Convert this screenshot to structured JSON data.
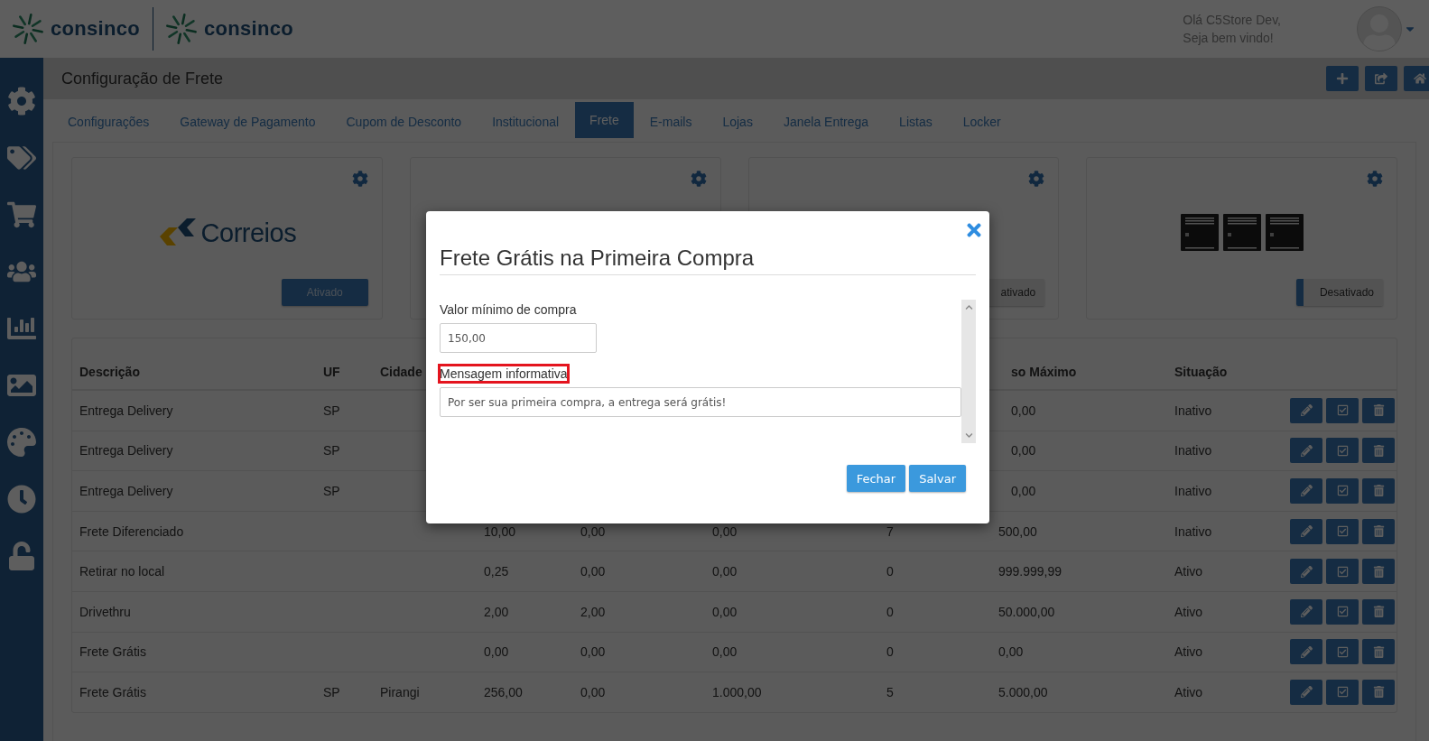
{
  "header": {
    "logos": [
      {
        "text": "consinco"
      },
      {
        "text": "consinco"
      }
    ],
    "greeting": "Olá C5Store Dev,",
    "welcome": "Seja bem vindo!"
  },
  "page": {
    "title": "Configuração de Frete"
  },
  "tabs": [
    {
      "label": "Configurações",
      "selected": false
    },
    {
      "label": "Gateway de Pagamento",
      "selected": false
    },
    {
      "label": "Cupom de Desconto",
      "selected": false
    },
    {
      "label": "Institucional",
      "selected": false
    },
    {
      "label": "Frete",
      "selected": true
    },
    {
      "label": "E-mails",
      "selected": false
    },
    {
      "label": "Lojas",
      "selected": false
    },
    {
      "label": "Janela Entrega",
      "selected": false
    },
    {
      "label": "Listas",
      "selected": false
    },
    {
      "label": "Locker",
      "selected": false
    }
  ],
  "cards": [
    {
      "kind": "correios",
      "logo_text": "Correios",
      "button": {
        "label": "Ativado",
        "on": true
      }
    },
    {
      "kind": "blank"
    },
    {
      "kind": "blank",
      "button": {
        "label": "ativado",
        "on": false
      }
    },
    {
      "kind": "lockers",
      "button": {
        "label": "Desativado",
        "on": false
      }
    }
  ],
  "table": {
    "columns": [
      {
        "label": "Descrição"
      },
      {
        "label": "UF"
      },
      {
        "label": "Cidade"
      },
      {},
      {},
      {},
      {},
      {
        "label": "so Máximo"
      },
      {
        "label": "Situação"
      }
    ],
    "rows": [
      {
        "cells": [
          "Entrega Delivery",
          "SP",
          null,
          null,
          null,
          null,
          null,
          "0,00",
          "Inativo"
        ]
      },
      {
        "cells": [
          "Entrega Delivery",
          "SP",
          null,
          null,
          null,
          null,
          null,
          "0,00",
          "Inativo"
        ]
      },
      {
        "cells": [
          "Entrega Delivery",
          "SP",
          null,
          null,
          null,
          null,
          null,
          "0,00",
          "Inativo"
        ]
      },
      {
        "cells": [
          "Frete Diferenciado",
          null,
          null,
          "10,00",
          "0,00",
          "0,00",
          "7",
          "500,00",
          "Inativo"
        ]
      },
      {
        "cells": [
          "Retirar no local",
          null,
          null,
          "0,25",
          "0,00",
          "0,00",
          "0",
          "999.999,99",
          "Ativo"
        ]
      },
      {
        "cells": [
          "Drivethru",
          null,
          null,
          "2,00",
          "2,00",
          "0,00",
          "0",
          "50.000,00",
          "Ativo"
        ]
      },
      {
        "cells": [
          "Frete Grátis",
          null,
          null,
          "0,00",
          "0,00",
          "0,00",
          "0",
          "0,00",
          "Ativo"
        ]
      },
      {
        "cells": [
          "Frete Grátis",
          "SP",
          "Pirangi",
          "256,00",
          "0,00",
          "1.000,00",
          "5",
          "5.000,00",
          "Ativo"
        ]
      }
    ]
  },
  "modal": {
    "title": "Frete Grátis na Primeira Compra",
    "fields": [
      {
        "kind": "short",
        "label": "Valor mínimo de compra",
        "value": "150,00",
        "highlighted": false
      },
      {
        "kind": "wide",
        "label": "Mensagem informativa",
        "value": "Por ser sua primeira compra, a entrega será grátis!",
        "highlighted": true
      }
    ],
    "buttons": [
      "Fechar",
      "Salvar"
    ]
  }
}
